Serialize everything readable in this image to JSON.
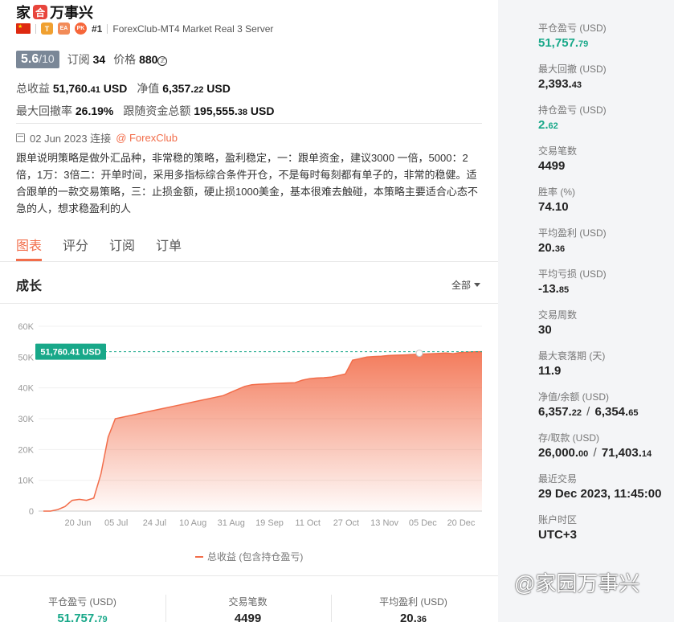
{
  "header": {
    "name": "家",
    "logo_glyph": "合",
    "name_rest": "万事兴",
    "badges": {
      "t": "T",
      "ea": "EA",
      "pk": "PK"
    },
    "rank": "#1",
    "server": "ForexClub-MT4 Market Real 3 Server"
  },
  "score": {
    "value": "5.6",
    "of": "/10"
  },
  "subscribe": {
    "label": "订阅",
    "value": "34"
  },
  "price": {
    "label": "价格",
    "value": "880"
  },
  "stats": {
    "total_profit_label": "总收益",
    "total_profit_main": "51,760.",
    "total_profit_dec": "41",
    "usd": "USD",
    "equity_label": "净值",
    "equity_main": "6,357.",
    "equity_dec": "22",
    "max_dd_label": "最大回撤率",
    "max_dd_value": "26.19%",
    "follow_label": "跟随资金总额",
    "follow_main": "195,555.",
    "follow_dec": "38"
  },
  "connect": {
    "date_text": "02 Jun 2023 连接",
    "broker": "@ ForexClub"
  },
  "description": "跟单说明策略是做外汇品种，非常稳的策略，盈利稳定，一：跟单资金，建议3000 一倍，5000：2倍，1万：3倍二：开单时间，采用多指标综合条件开仓，不是每时每刻都有单子的，非常的稳健。适合跟单的一款交易策略，三：止损金额，硬止损1000美金，基本很难去触碰，本策略主要适合心态不急的人，想求稳盈利的人",
  "tabs": [
    "图表",
    "评分",
    "订阅",
    "订单"
  ],
  "growth": {
    "title": "成长",
    "filter": "全部"
  },
  "chart_data": {
    "type": "area",
    "ylabel": "",
    "ylim": [
      0,
      60000
    ],
    "yticks": [
      "0",
      "10K",
      "20K",
      "30K",
      "40K",
      "50K",
      "60K"
    ],
    "xticks": [
      "20 Jun",
      "05 Jul",
      "24 Jul",
      "10 Aug",
      "31 Aug",
      "19 Sep",
      "11 Oct",
      "27 Oct",
      "13 Nov",
      "05 Dec",
      "20 Dec"
    ],
    "current_label": "51,760.41 USD",
    "current_value": 51760.41,
    "legend": "总收益 (包含持仓盈亏)",
    "color": "#f26d4a",
    "series": [
      {
        "name": "总收益 (包含持仓盈亏)",
        "values": [
          0,
          0,
          500,
          1500,
          3500,
          3800,
          3500,
          4200,
          12000,
          24000,
          30000,
          30500,
          31000,
          31500,
          32000,
          32500,
          33000,
          33500,
          34000,
          34500,
          35000,
          35500,
          36000,
          36500,
          37000,
          37500,
          38500,
          39500,
          40500,
          41000,
          41200,
          41300,
          41400,
          41500,
          41600,
          41700,
          42500,
          43000,
          43200,
          43300,
          43500,
          44000,
          44500,
          49000,
          49500,
          50000,
          50200,
          50300,
          50500,
          50600,
          50700,
          50800,
          50900,
          51000,
          51100,
          51200,
          51300,
          51100,
          51500,
          51600,
          51700,
          51760
        ]
      }
    ]
  },
  "bottom": [
    {
      "label": "平仓盈亏 (USD)",
      "main": "51,757.",
      "dec": "79",
      "color": "green"
    },
    {
      "label": "交易笔数",
      "main": "4499",
      "dec": "",
      "color": ""
    },
    {
      "label": "平均盈利 (USD)",
      "main": "20.",
      "dec": "36",
      "color": ""
    }
  ],
  "right": [
    {
      "label": "平仓盈亏 (USD)",
      "main": "51,757.",
      "dec": "79",
      "color": "green"
    },
    {
      "label": "最大回撤 (USD)",
      "main": "2,393.",
      "dec": "43",
      "color": ""
    },
    {
      "label": "持仓盈亏 (USD)",
      "main": "2.",
      "dec": "62",
      "color": "green"
    },
    {
      "label": "交易笔数",
      "main": "4499",
      "dec": "",
      "color": ""
    },
    {
      "label": "胜率 (%)",
      "main": "74.10",
      "dec": "",
      "color": ""
    },
    {
      "label": "平均盈利 (USD)",
      "main": "20.",
      "dec": "36",
      "color": ""
    },
    {
      "label": "平均亏损 (USD)",
      "main": "-13.",
      "dec": "85",
      "color": ""
    },
    {
      "label": "交易周数",
      "main": "30",
      "dec": "",
      "color": ""
    },
    {
      "label": "最大衰落期 (天)",
      "main": "11.9",
      "dec": "",
      "color": ""
    },
    {
      "label": "净值/余额 (USD)",
      "main": "6,357.",
      "dec": "22",
      "main2": "6,354.",
      "dec2": "65",
      "color": ""
    },
    {
      "label": "存/取款 (USD)",
      "main": "26,000.",
      "dec": "00",
      "main2": "71,403.",
      "dec2": "14",
      "color": ""
    },
    {
      "label": "最近交易",
      "main": "29 Dec 2023, 11:45:00",
      "dec": "",
      "color": ""
    },
    {
      "label": "账户时区",
      "main": "UTC+3",
      "dec": "",
      "color": ""
    }
  ],
  "watermark": "@家园万事兴"
}
